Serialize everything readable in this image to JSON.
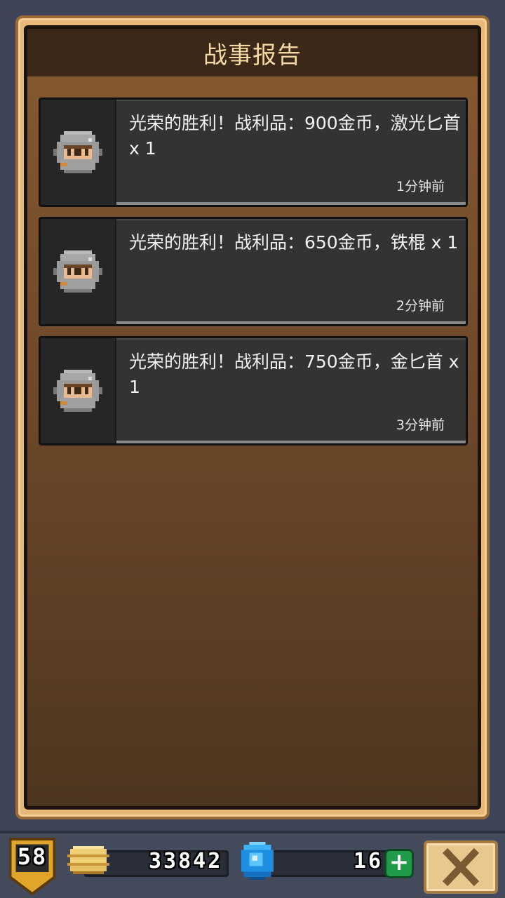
{
  "panel": {
    "title": "战事报告"
  },
  "reports": [
    {
      "text": "光荣的胜利！战利品：900金币，激光匕首 x 1",
      "time": "1分钟前"
    },
    {
      "text": "光荣的胜利！战利品：650金币，铁棍 x 1",
      "time": "2分钟前"
    },
    {
      "text": "光荣的胜利！战利品：750金币，金匕首 x 1",
      "time": "3分钟前"
    }
  ],
  "status_bar": {
    "level": "58",
    "gold": "33842",
    "gems": "16"
  },
  "colors": {
    "panel_header": "#3b2818",
    "frame_gold": "#e7b877",
    "card_bg": "#333333",
    "plus_green": "#1f9b4a"
  },
  "icons": {
    "avatar": "knight-helmet-icon",
    "gold": "coin-stack-icon",
    "gems": "blue-gem-icon",
    "add": "plus-icon",
    "close": "close-x-icon"
  }
}
